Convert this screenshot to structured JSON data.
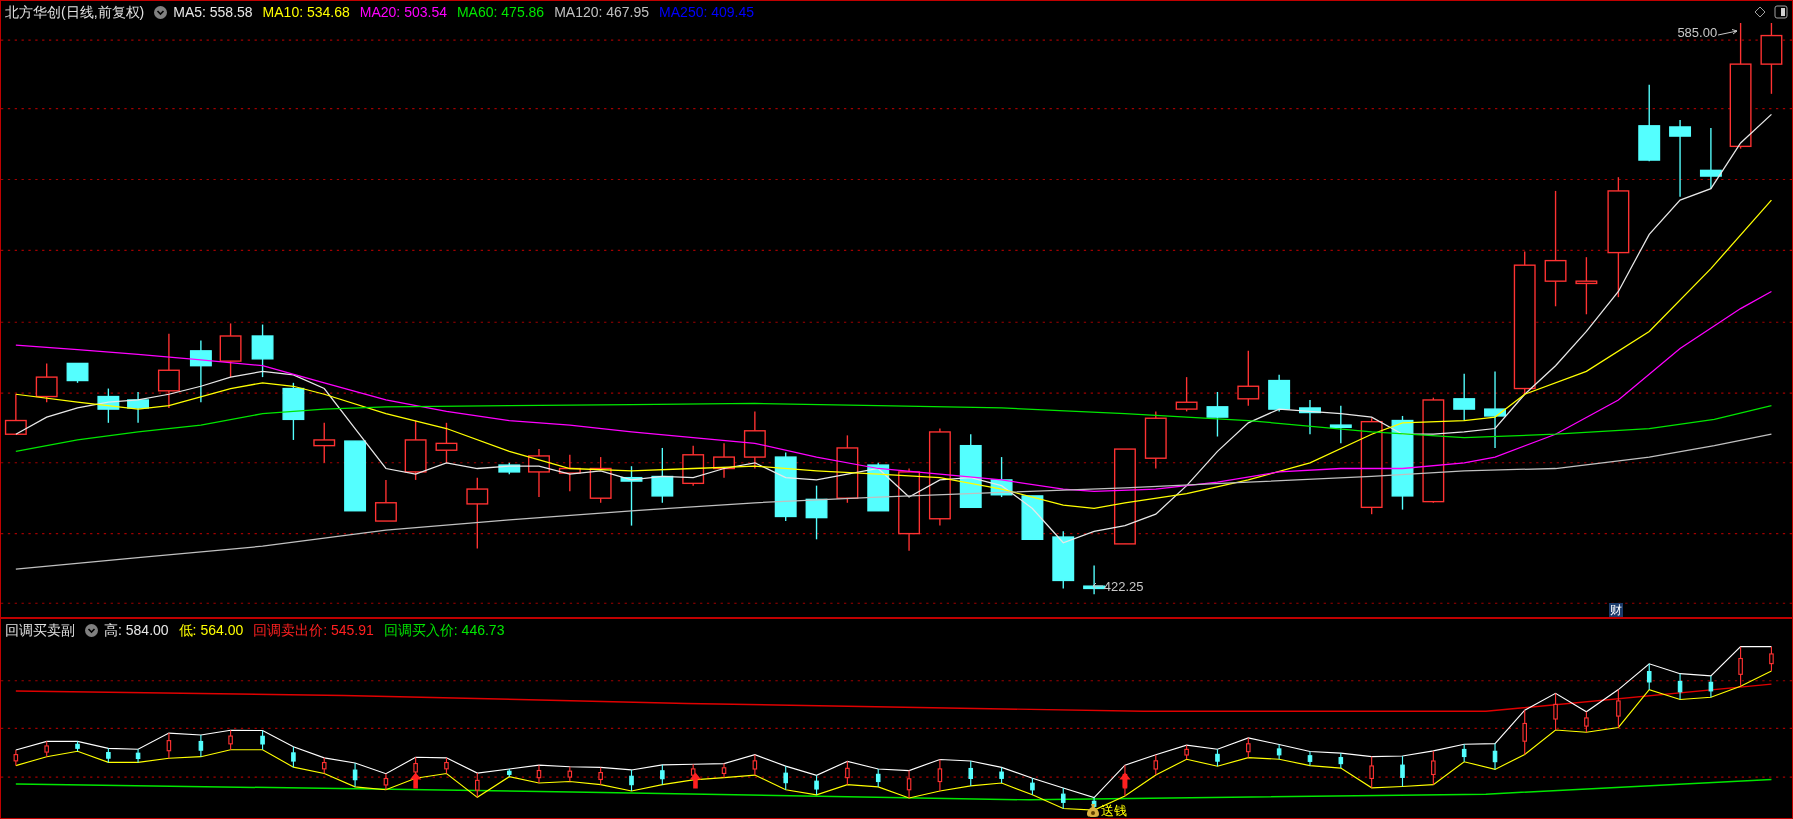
{
  "main_chart": {
    "title": "北方华创(日线,前复权)",
    "ma_lines": [
      {
        "label": "MA5: 558.58",
        "color": "#e8e8e8"
      },
      {
        "label": "MA10: 534.68",
        "color": "#ffff00"
      },
      {
        "label": "MA20: 503.54",
        "color": "#ff00ff"
      },
      {
        "label": "MA60: 475.86",
        "color": "#00e600"
      },
      {
        "label": "MA120: 467.95",
        "color": "#c0c0c0"
      },
      {
        "label": "MA250: 409.45",
        "color": "#0000ff"
      }
    ],
    "high_label": "585.00",
    "low_label": "422.25",
    "badge": "财"
  },
  "sub_chart": {
    "title": "回调买卖副",
    "items": [
      {
        "label": "高: 584.00",
        "color": "#e8e8e8"
      },
      {
        "label": "低: 564.00",
        "color": "#ffff00"
      },
      {
        "label": "回调卖出价: 545.91",
        "color": "#ff2020"
      },
      {
        "label": "回调买入价: 446.73",
        "color": "#00e600"
      }
    ],
    "signal_label": "送钱"
  }
}
